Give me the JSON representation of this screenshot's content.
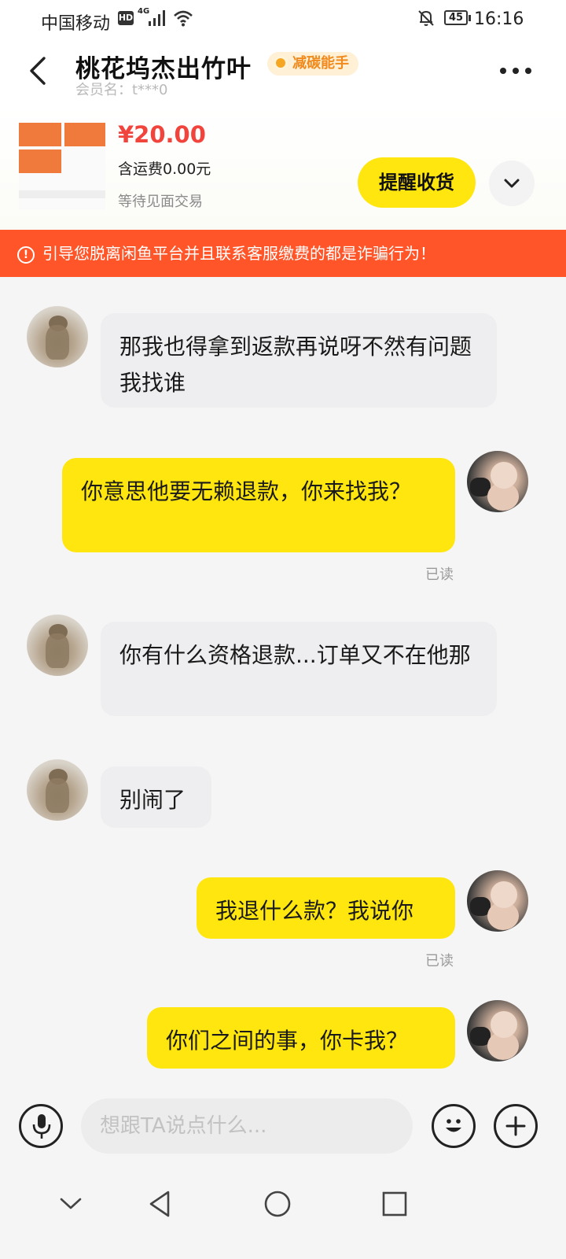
{
  "status_bar": {
    "carrier": "中国移动",
    "hd": "HD",
    "network": "4G",
    "battery": "45",
    "time": "16:16"
  },
  "header": {
    "title": "桃花坞杰出竹叶",
    "badge": "减碳能手",
    "member": "会员名：t***0"
  },
  "order": {
    "price": "¥20.00",
    "shipping": "含运费0.00元",
    "status": "等待见面交易",
    "remind_button": "提醒收货"
  },
  "warning": {
    "icon": "!",
    "text": "引导您脱离闲鱼平台并且联系客服缴费的都是诈骗行为！"
  },
  "messages": [
    {
      "side": "in",
      "text": "那我也得拿到返款再说呀不然有问题我找谁"
    },
    {
      "side": "out",
      "text": "你意思他要无赖退款，你来找我？",
      "status": "已读"
    },
    {
      "side": "in",
      "text": "你有什么资格退款...订单又不在他那"
    },
    {
      "side": "in",
      "text": "别闹了"
    },
    {
      "side": "out",
      "text": "我退什么款？我说你",
      "status": "已读"
    },
    {
      "side": "out",
      "text": "你们之间的事，你卡我？"
    }
  ],
  "input": {
    "placeholder": "想跟TA说点什么..."
  },
  "icons": {
    "back": "chevron-left-icon",
    "more": "more-dots-icon",
    "mic": "microphone-icon",
    "emoji": "smiley-icon",
    "plus": "plus-icon"
  },
  "colors": {
    "accent_yellow": "#ffe60f",
    "warning_bg": "#ff5528",
    "price_red": "#f0443c",
    "badge_orange": "#f08a1c"
  }
}
